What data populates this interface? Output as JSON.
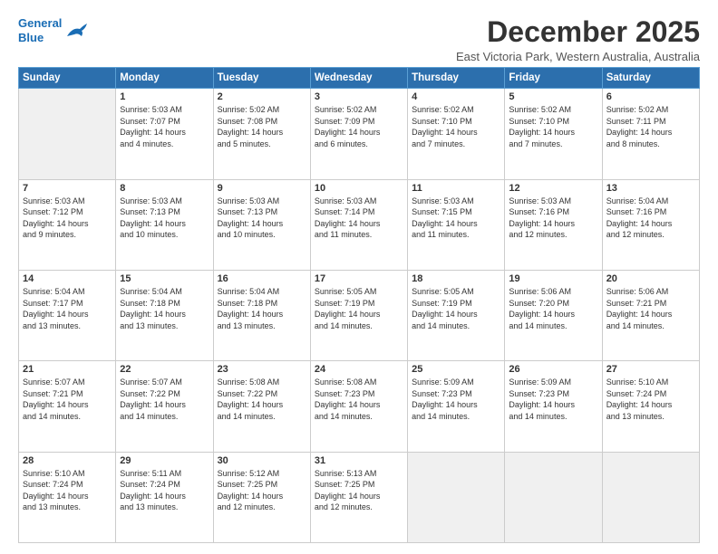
{
  "header": {
    "logo_line1": "General",
    "logo_line2": "Blue",
    "month": "December 2025",
    "location": "East Victoria Park, Western Australia, Australia"
  },
  "weekdays": [
    "Sunday",
    "Monday",
    "Tuesday",
    "Wednesday",
    "Thursday",
    "Friday",
    "Saturday"
  ],
  "rows": [
    [
      {
        "day": "",
        "info": ""
      },
      {
        "day": "1",
        "info": "Sunrise: 5:03 AM\nSunset: 7:07 PM\nDaylight: 14 hours\nand 4 minutes."
      },
      {
        "day": "2",
        "info": "Sunrise: 5:02 AM\nSunset: 7:08 PM\nDaylight: 14 hours\nand 5 minutes."
      },
      {
        "day": "3",
        "info": "Sunrise: 5:02 AM\nSunset: 7:09 PM\nDaylight: 14 hours\nand 6 minutes."
      },
      {
        "day": "4",
        "info": "Sunrise: 5:02 AM\nSunset: 7:10 PM\nDaylight: 14 hours\nand 7 minutes."
      },
      {
        "day": "5",
        "info": "Sunrise: 5:02 AM\nSunset: 7:10 PM\nDaylight: 14 hours\nand 7 minutes."
      },
      {
        "day": "6",
        "info": "Sunrise: 5:02 AM\nSunset: 7:11 PM\nDaylight: 14 hours\nand 8 minutes."
      }
    ],
    [
      {
        "day": "7",
        "info": "Sunrise: 5:03 AM\nSunset: 7:12 PM\nDaylight: 14 hours\nand 9 minutes."
      },
      {
        "day": "8",
        "info": "Sunrise: 5:03 AM\nSunset: 7:13 PM\nDaylight: 14 hours\nand 10 minutes."
      },
      {
        "day": "9",
        "info": "Sunrise: 5:03 AM\nSunset: 7:13 PM\nDaylight: 14 hours\nand 10 minutes."
      },
      {
        "day": "10",
        "info": "Sunrise: 5:03 AM\nSunset: 7:14 PM\nDaylight: 14 hours\nand 11 minutes."
      },
      {
        "day": "11",
        "info": "Sunrise: 5:03 AM\nSunset: 7:15 PM\nDaylight: 14 hours\nand 11 minutes."
      },
      {
        "day": "12",
        "info": "Sunrise: 5:03 AM\nSunset: 7:16 PM\nDaylight: 14 hours\nand 12 minutes."
      },
      {
        "day": "13",
        "info": "Sunrise: 5:04 AM\nSunset: 7:16 PM\nDaylight: 14 hours\nand 12 minutes."
      }
    ],
    [
      {
        "day": "14",
        "info": "Sunrise: 5:04 AM\nSunset: 7:17 PM\nDaylight: 14 hours\nand 13 minutes."
      },
      {
        "day": "15",
        "info": "Sunrise: 5:04 AM\nSunset: 7:18 PM\nDaylight: 14 hours\nand 13 minutes."
      },
      {
        "day": "16",
        "info": "Sunrise: 5:04 AM\nSunset: 7:18 PM\nDaylight: 14 hours\nand 13 minutes."
      },
      {
        "day": "17",
        "info": "Sunrise: 5:05 AM\nSunset: 7:19 PM\nDaylight: 14 hours\nand 14 minutes."
      },
      {
        "day": "18",
        "info": "Sunrise: 5:05 AM\nSunset: 7:19 PM\nDaylight: 14 hours\nand 14 minutes."
      },
      {
        "day": "19",
        "info": "Sunrise: 5:06 AM\nSunset: 7:20 PM\nDaylight: 14 hours\nand 14 minutes."
      },
      {
        "day": "20",
        "info": "Sunrise: 5:06 AM\nSunset: 7:21 PM\nDaylight: 14 hours\nand 14 minutes."
      }
    ],
    [
      {
        "day": "21",
        "info": "Sunrise: 5:07 AM\nSunset: 7:21 PM\nDaylight: 14 hours\nand 14 minutes."
      },
      {
        "day": "22",
        "info": "Sunrise: 5:07 AM\nSunset: 7:22 PM\nDaylight: 14 hours\nand 14 minutes."
      },
      {
        "day": "23",
        "info": "Sunrise: 5:08 AM\nSunset: 7:22 PM\nDaylight: 14 hours\nand 14 minutes."
      },
      {
        "day": "24",
        "info": "Sunrise: 5:08 AM\nSunset: 7:23 PM\nDaylight: 14 hours\nand 14 minutes."
      },
      {
        "day": "25",
        "info": "Sunrise: 5:09 AM\nSunset: 7:23 PM\nDaylight: 14 hours\nand 14 minutes."
      },
      {
        "day": "26",
        "info": "Sunrise: 5:09 AM\nSunset: 7:23 PM\nDaylight: 14 hours\nand 14 minutes."
      },
      {
        "day": "27",
        "info": "Sunrise: 5:10 AM\nSunset: 7:24 PM\nDaylight: 14 hours\nand 13 minutes."
      }
    ],
    [
      {
        "day": "28",
        "info": "Sunrise: 5:10 AM\nSunset: 7:24 PM\nDaylight: 14 hours\nand 13 minutes."
      },
      {
        "day": "29",
        "info": "Sunrise: 5:11 AM\nSunset: 7:24 PM\nDaylight: 14 hours\nand 13 minutes."
      },
      {
        "day": "30",
        "info": "Sunrise: 5:12 AM\nSunset: 7:25 PM\nDaylight: 14 hours\nand 12 minutes."
      },
      {
        "day": "31",
        "info": "Sunrise: 5:13 AM\nSunset: 7:25 PM\nDaylight: 14 hours\nand 12 minutes."
      },
      {
        "day": "",
        "info": ""
      },
      {
        "day": "",
        "info": ""
      },
      {
        "day": "",
        "info": ""
      }
    ]
  ]
}
